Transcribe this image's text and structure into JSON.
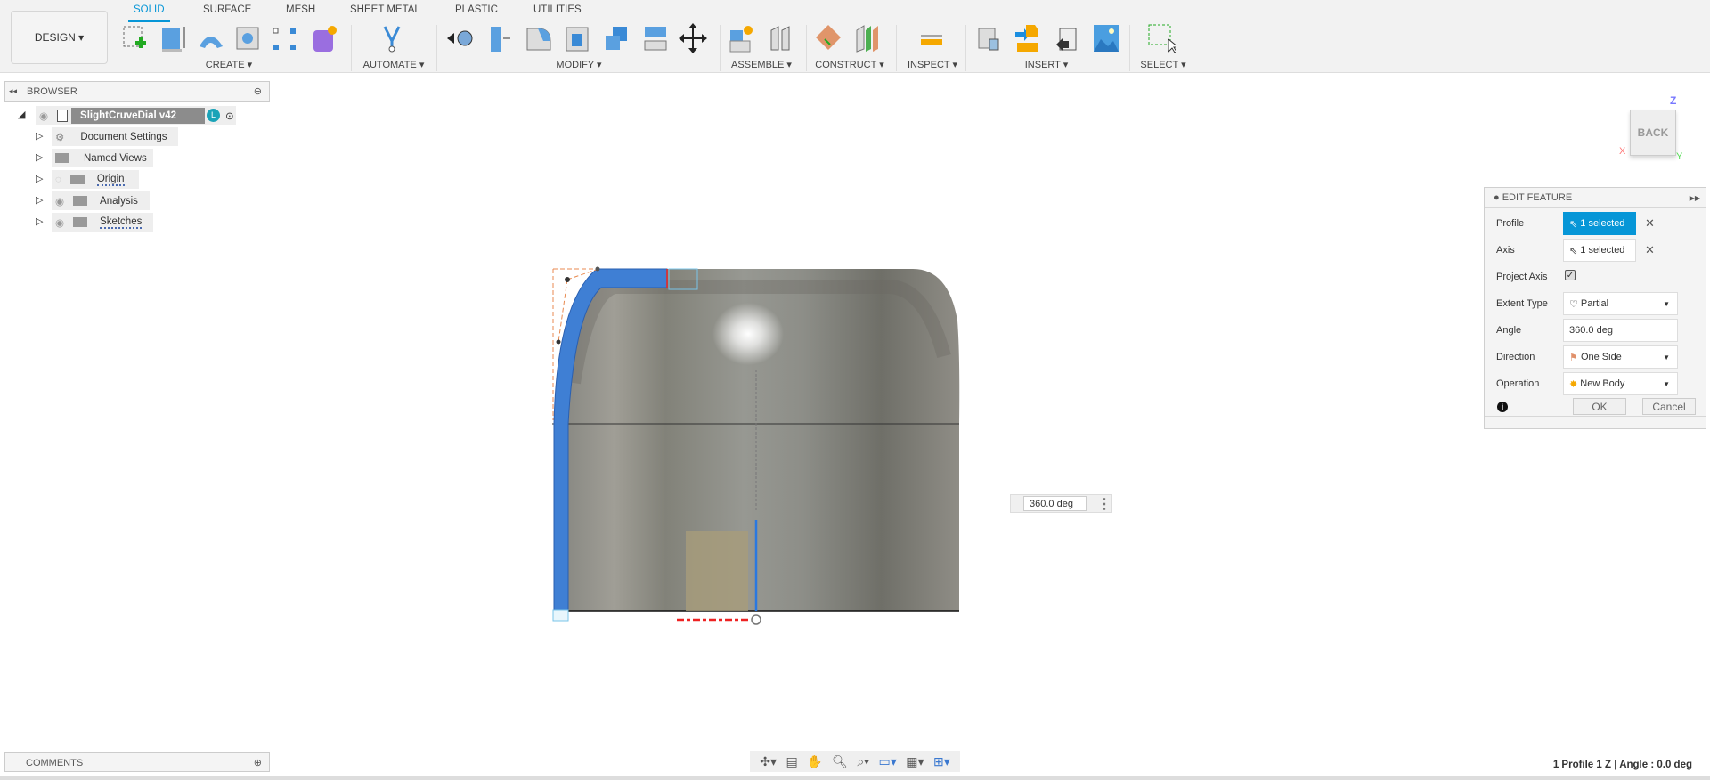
{
  "toolbar": {
    "workspace": "DESIGN",
    "tabs": [
      "SOLID",
      "SURFACE",
      "MESH",
      "SHEET METAL",
      "PLASTIC",
      "UTILITIES"
    ],
    "groups": [
      "CREATE",
      "AUTOMATE",
      "MODIFY",
      "ASSEMBLE",
      "CONSTRUCT",
      "INSPECT",
      "INSERT",
      "SELECT"
    ]
  },
  "browser": {
    "title": "BROWSER",
    "root": "SlightCruveDial v42",
    "root_badge": "L",
    "items": [
      "Document Settings",
      "Named Views",
      "Origin",
      "Analysis",
      "Sketches"
    ]
  },
  "comments": {
    "title": "COMMENTS"
  },
  "panel": {
    "title": "EDIT FEATURE",
    "rows": {
      "profile": {
        "label": "Profile",
        "value": "1 selected"
      },
      "axis": {
        "label": "Axis",
        "value": "1 selected"
      },
      "project_axis": {
        "label": "Project Axis",
        "checked": true
      },
      "extent_type": {
        "label": "Extent Type",
        "value": "Partial"
      },
      "angle": {
        "label": "Angle",
        "value": "360.0 deg"
      },
      "direction": {
        "label": "Direction",
        "value": "One Side"
      },
      "operation": {
        "label": "Operation",
        "value": "New Body"
      }
    },
    "ok": "OK",
    "cancel": "Cancel"
  },
  "viewport": {
    "angle_input": "360.0 deg",
    "viewcube": {
      "face": "BACK",
      "z": "Z",
      "x": "X",
      "y": "Y"
    }
  },
  "status": "1 Profile 1 Z | Angle : 0.0 deg",
  "colors": {
    "accent": "#0696d7",
    "profile": "#3a78d0"
  }
}
